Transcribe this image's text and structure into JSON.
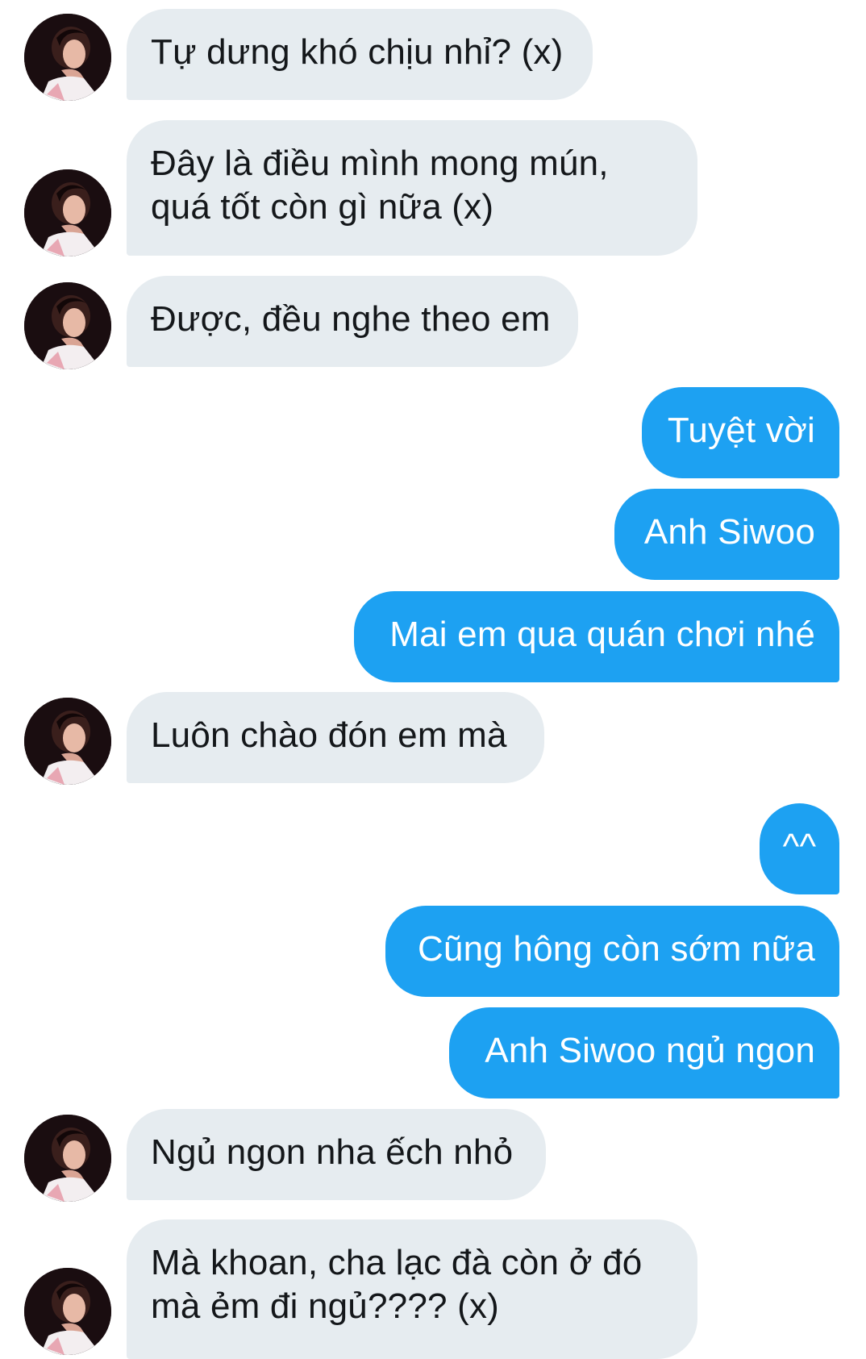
{
  "conversation": {
    "messages": [
      {
        "sender": "other",
        "text": "Tự dưng khó chịu nhỉ? (x)"
      },
      {
        "sender": "other",
        "text": "Đây là điều mình mong mún,\nquá tốt còn gì nữa (x)"
      },
      {
        "sender": "other",
        "text": "Được, đều nghe theo em"
      },
      {
        "sender": "me",
        "text": "Tuyệt vời"
      },
      {
        "sender": "me",
        "text": "Anh Siwoo"
      },
      {
        "sender": "me",
        "text": "Mai em qua quán chơi nhé"
      },
      {
        "sender": "other",
        "text": "Luôn chào đón em mà"
      },
      {
        "sender": "me",
        "text": "^^"
      },
      {
        "sender": "me",
        "text": "Cũng hông còn sớm nữa"
      },
      {
        "sender": "me",
        "text": "Anh Siwoo ngủ ngon"
      },
      {
        "sender": "other",
        "text": "Ngủ ngon nha ếch nhỏ"
      },
      {
        "sender": "other",
        "text": "Mà khoan, cha lạc đà còn ở đó\nmà ẻm đi ngủ???? (x)"
      }
    ]
  },
  "colors": {
    "incoming_bubble": "#e6ecf0",
    "incoming_text": "#14171a",
    "outgoing_bubble": "#1da1f2",
    "outgoing_text": "#ffffff",
    "background": "#ffffff"
  },
  "icons": {
    "avatar": "user-avatar-photo"
  }
}
